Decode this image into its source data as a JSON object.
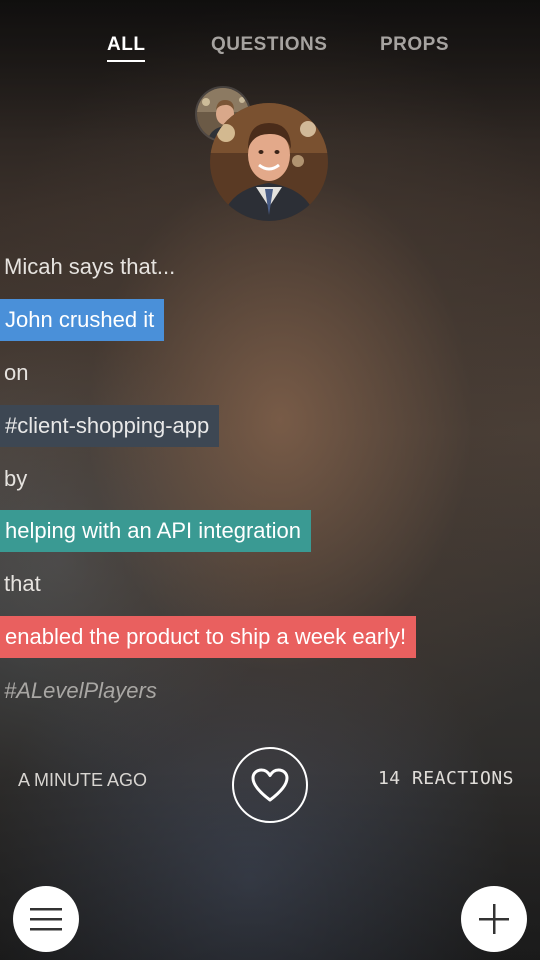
{
  "tabs": [
    {
      "label": "ALL",
      "active": true
    },
    {
      "label": "QUESTIONS",
      "active": false
    },
    {
      "label": "PROPS",
      "active": false
    }
  ],
  "post": {
    "intro": "Micah says that...",
    "who": "John crushed it",
    "on_label": "on",
    "channel": "#client-shopping-app",
    "by_label": "by",
    "action": "helping with an API integration",
    "that_label": "that",
    "outcome": "enabled the product to ship a week early!",
    "tag": "#ALevelPlayers"
  },
  "meta": {
    "time": "A MINUTE AGO",
    "reactions": "14 REACTIONS"
  },
  "icons": {
    "heart": "heart-icon",
    "menu": "menu-icon",
    "add": "plus-icon"
  },
  "colors": {
    "who": "#4a90d9",
    "channel": "#3d4753",
    "action": "#3a9a93",
    "outcome": "#e9605f"
  }
}
